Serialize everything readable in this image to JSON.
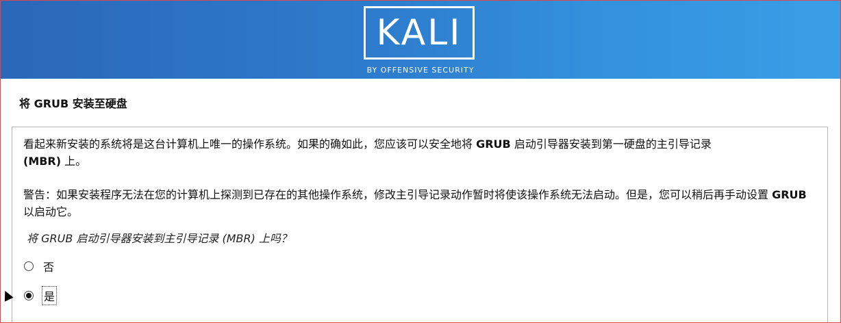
{
  "banner": {
    "logo_text": "KALI",
    "logo_subtitle": "BY OFFENSIVE SECURITY"
  },
  "page": {
    "title": "将 GRUB 安装至硬盘"
  },
  "body": {
    "p1_a": "看起来新安装的系统将是这台计算机上唯一的操作系统。如果的确如此，您应该可以安全地将 ",
    "p1_b": "GRUB",
    "p1_c": " 启动引导器安装到第一硬盘的主引导记录",
    "p1_d": "(MBR)",
    "p1_e": " 上。",
    "p2_a": "警告：如果安装程序无法在您的计算机上探测到已存在的其他操作系统，修改主引导记录动作暂时将使该操作系统无法启动。但是，您可以稍后再手动设置 ",
    "p2_b": "GRUB",
    "p2_c": " 以启动它。",
    "question": "将 GRUB 启动引导器安装到主引导记录 (MBR) 上吗？"
  },
  "options": [
    {
      "label": "否",
      "selected": false
    },
    {
      "label": "是",
      "selected": true
    }
  ],
  "colors": {
    "banner_left": "#2c67b8",
    "banner_right": "#3a9ee6",
    "frame_border": "#e0474c"
  }
}
